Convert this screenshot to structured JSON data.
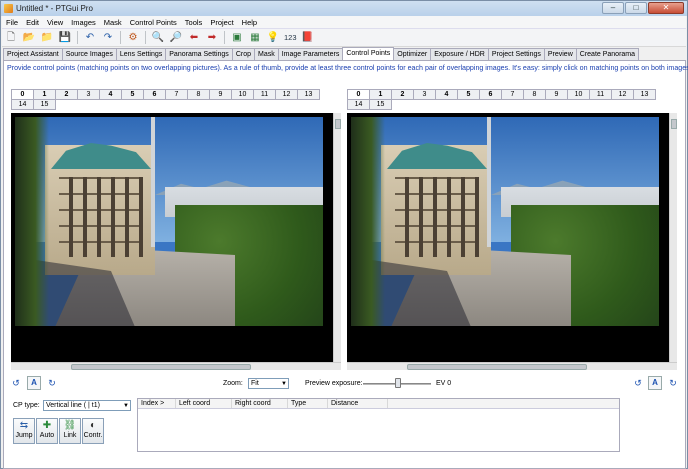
{
  "window": {
    "title": "Untitled * - PTGui Pro",
    "minimize": "–",
    "maximize": "□",
    "close": "✕"
  },
  "menu": [
    "File",
    "Edit",
    "View",
    "Images",
    "Mask",
    "Control Points",
    "Tools",
    "Project",
    "Help"
  ],
  "toolbar": {
    "counter_label": "123"
  },
  "tabs": [
    "Project Assistant",
    "Source Images",
    "Lens Settings",
    "Panorama Settings",
    "Crop",
    "Mask",
    "Image Parameters",
    "Control Points",
    "Optimizer",
    "Exposure / HDR",
    "Project Settings",
    "Preview",
    "Create Panorama"
  ],
  "active_tab": "Control Points",
  "instructions": "Provide control points (matching points on two overlapping pictures). As a rule of thumb, provide at least three control points for each pair of overlapping images. It's easy: simply click on matching points on both images.",
  "left_image_tabs": [
    "0",
    "1",
    "2",
    "3",
    "4",
    "5",
    "6",
    "7",
    "8",
    "9",
    "10",
    "11",
    "12",
    "13",
    "14",
    "15"
  ],
  "right_image_tabs": [
    "0",
    "1",
    "2",
    "3",
    "4",
    "5",
    "6",
    "7",
    "8",
    "9",
    "10",
    "11",
    "12",
    "13",
    "14",
    "15"
  ],
  "left_active": "0",
  "right_active": "0",
  "view_controls": {
    "zoom_label": "Zoom:",
    "zoom_value": "Fit",
    "exposure_label": "Preview exposure:",
    "exposure_value": "EV 0",
    "auto_label": "A"
  },
  "cp_panel": {
    "cp_type_label": "CP type:",
    "cp_type_value": "Vertical line   ( | t1)",
    "buttons": [
      "Jump",
      "Auto",
      "Link",
      "Contr."
    ],
    "columns": [
      "Index >",
      "Left coord",
      "Right coord",
      "Type",
      "Distance"
    ]
  },
  "colors": {
    "instruction_text": "#1a3fb0",
    "viewer_bg": "#000000",
    "accent": "#1a50b0"
  }
}
